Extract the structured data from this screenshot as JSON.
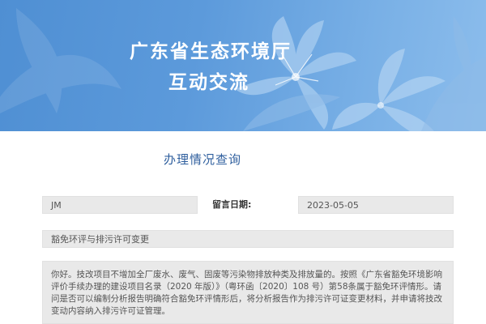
{
  "banner": {
    "title": "广东省生态环境厅",
    "subtitle": "互动交流"
  },
  "page": {
    "heading": "办理情况查询"
  },
  "record": {
    "name": "JM",
    "date_label": "留言日期:",
    "date": "2023-05-05",
    "subject": "豁免环评与排污许可变更",
    "body": "你好。技改项目不增加全厂废水、废气、固废等污染物排放种类及排放量的。按照《广东省豁免环境影响评价手续办理的建设项目名录（2020 年版）》（粤环函〔2020〕108 号）第58条属于豁免环评情形。请问是否可以编制分析报告明确符合豁免环评情形后，将分析报告作为排污许可证变更材料，并申请将技改变动内容纳入排污许可证管理。"
  },
  "colors": {
    "banner": "#5c9adb",
    "heading": "#2f5f9e",
    "field_bg": "#e9e9e9"
  }
}
